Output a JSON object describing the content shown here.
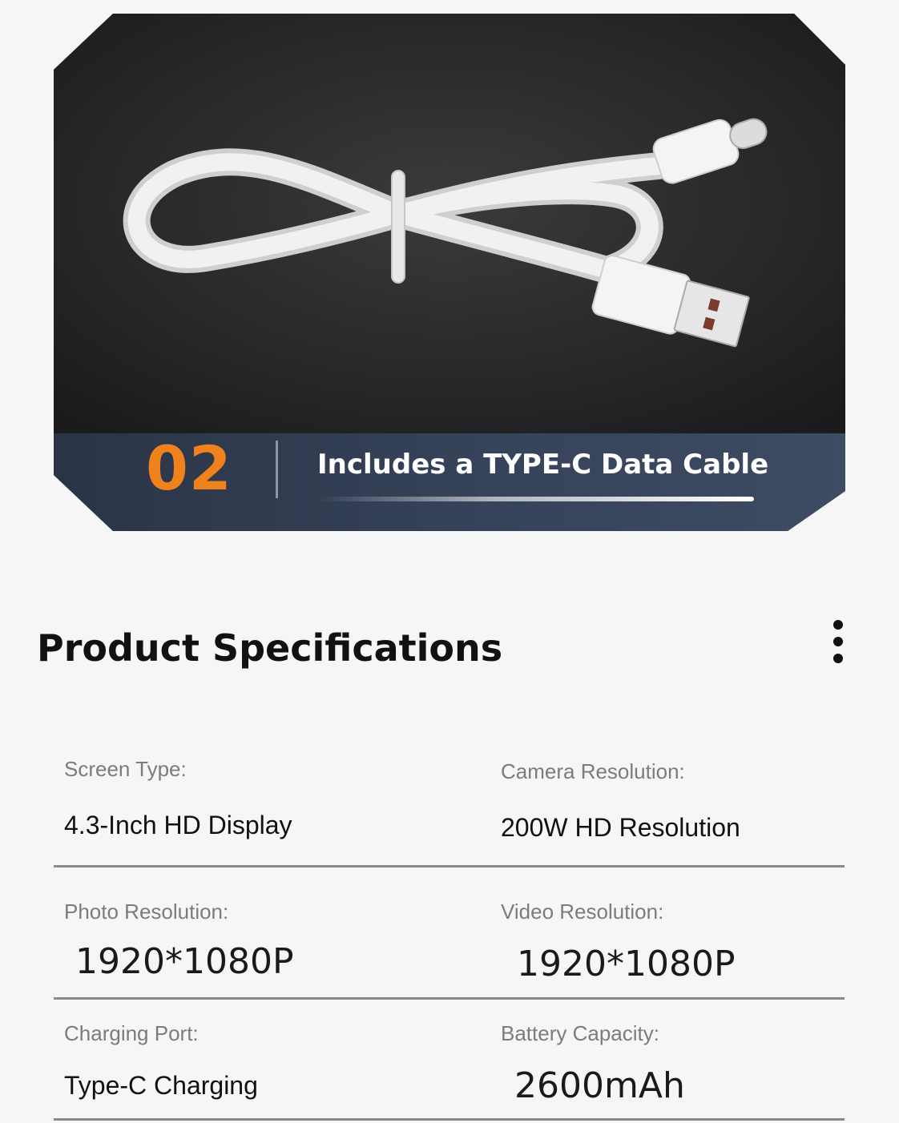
{
  "hero": {
    "number": "02",
    "caption": "Includes a TYPE-C Data Cable",
    "image_alt": "white USB-A to Type-C cable coiled on dark background"
  },
  "specs": {
    "title": "Product Specifications",
    "menu_icon": "more-vertical-icon",
    "items": [
      {
        "label": "Screen Type:",
        "value": "4.3-Inch HD Display"
      },
      {
        "label": "Camera Resolution:",
        "value": "200W HD Resolution"
      },
      {
        "label": "Photo Resolution:",
        "value": "1920*1080P"
      },
      {
        "label": "Video Resolution:",
        "value": "1920*1080P"
      },
      {
        "label": "Charging Port:",
        "value": "Type-C Charging"
      },
      {
        "label": "Battery Capacity:",
        "value": "2600mAh"
      }
    ]
  },
  "colors": {
    "accent_number": "#f0821e",
    "hero_bar": "#36435a",
    "hero_background": "#262628",
    "label_gray": "#7c7c7c",
    "rule_gray": "#8a8a8a"
  }
}
